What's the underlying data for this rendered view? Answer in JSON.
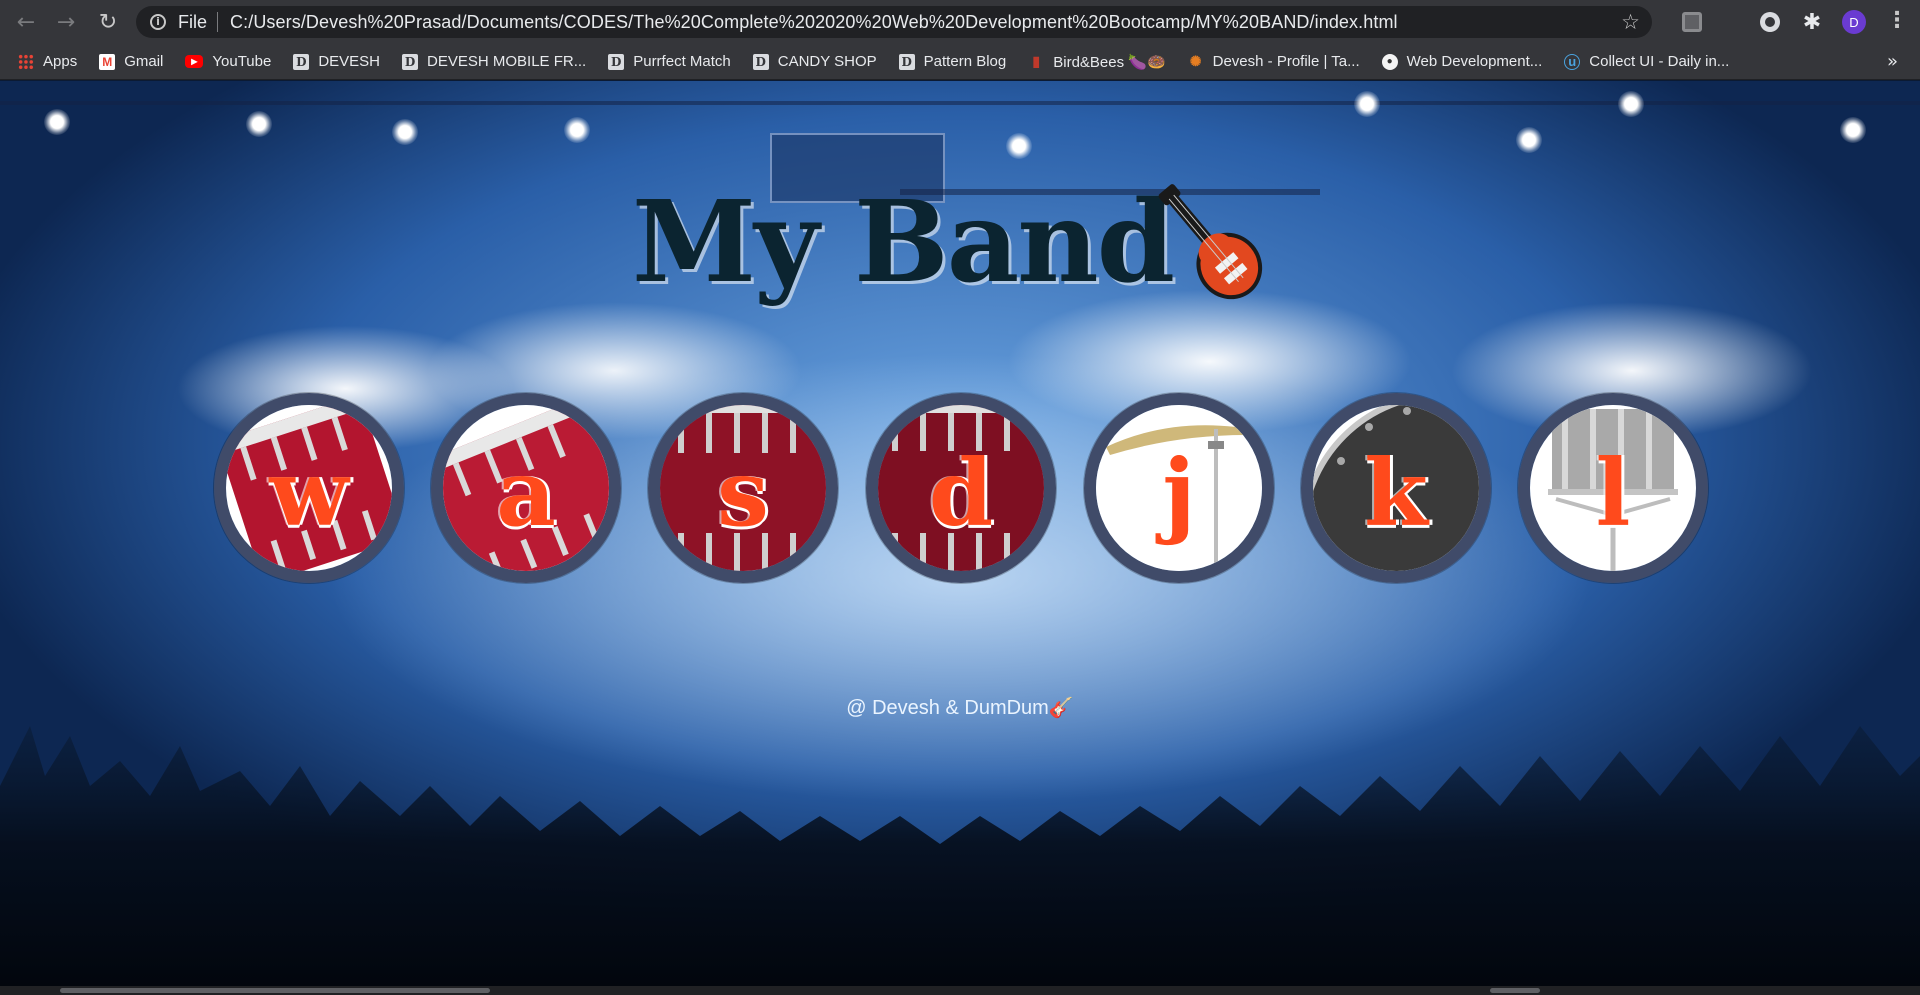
{
  "browser": {
    "file_label": "File",
    "url": "C:/Users/Devesh%20Prasad/Documents/CODES/The%20Complete%202020%20Web%20Development%20Bootcamp/MY%20BAND/index.html",
    "avatar_letter": "D",
    "bookmarks": [
      {
        "label": "Apps",
        "icon": "apps-grid-icon"
      },
      {
        "label": "Gmail",
        "icon": "gmail-icon"
      },
      {
        "label": "YouTube",
        "icon": "youtube-icon"
      },
      {
        "label": "DEVESH",
        "icon": "d-favicon"
      },
      {
        "label": "DEVESH MOBILE FR...",
        "icon": "d-favicon"
      },
      {
        "label": "Purrfect Match",
        "icon": "d-favicon"
      },
      {
        "label": "CANDY SHOP",
        "icon": "d-favicon"
      },
      {
        "label": "Pattern Blog",
        "icon": "d-favicon"
      },
      {
        "label": "Bird&Bees 🍆🍩",
        "icon": "bird-icon"
      },
      {
        "label": "Devesh - Profile | Ta...",
        "icon": "devpost-icon"
      },
      {
        "label": "Web Development...",
        "icon": "web-dev-icon"
      },
      {
        "label": "Collect UI - Daily in...",
        "icon": "collect-ui-icon"
      }
    ]
  },
  "page": {
    "title": "My Band",
    "title_emoji_icon": "guitar-icon",
    "drums": [
      {
        "key": "w",
        "image": "tom-drum-1"
      },
      {
        "key": "a",
        "image": "tom-drum-2"
      },
      {
        "key": "s",
        "image": "tom-drum-3"
      },
      {
        "key": "d",
        "image": "tom-drum-4"
      },
      {
        "key": "j",
        "image": "crash-cymbal"
      },
      {
        "key": "k",
        "image": "kick-drum"
      },
      {
        "key": "l",
        "image": "snare-drum"
      }
    ],
    "footer": "@ Devesh & DumDum🎸"
  },
  "colors": {
    "title_text": "#0b2430",
    "drum_ring": "#404b69",
    "drum_letter": "#ff4a1c",
    "footer_text": "#eaf4ff",
    "chrome_bg": "#35363a"
  }
}
